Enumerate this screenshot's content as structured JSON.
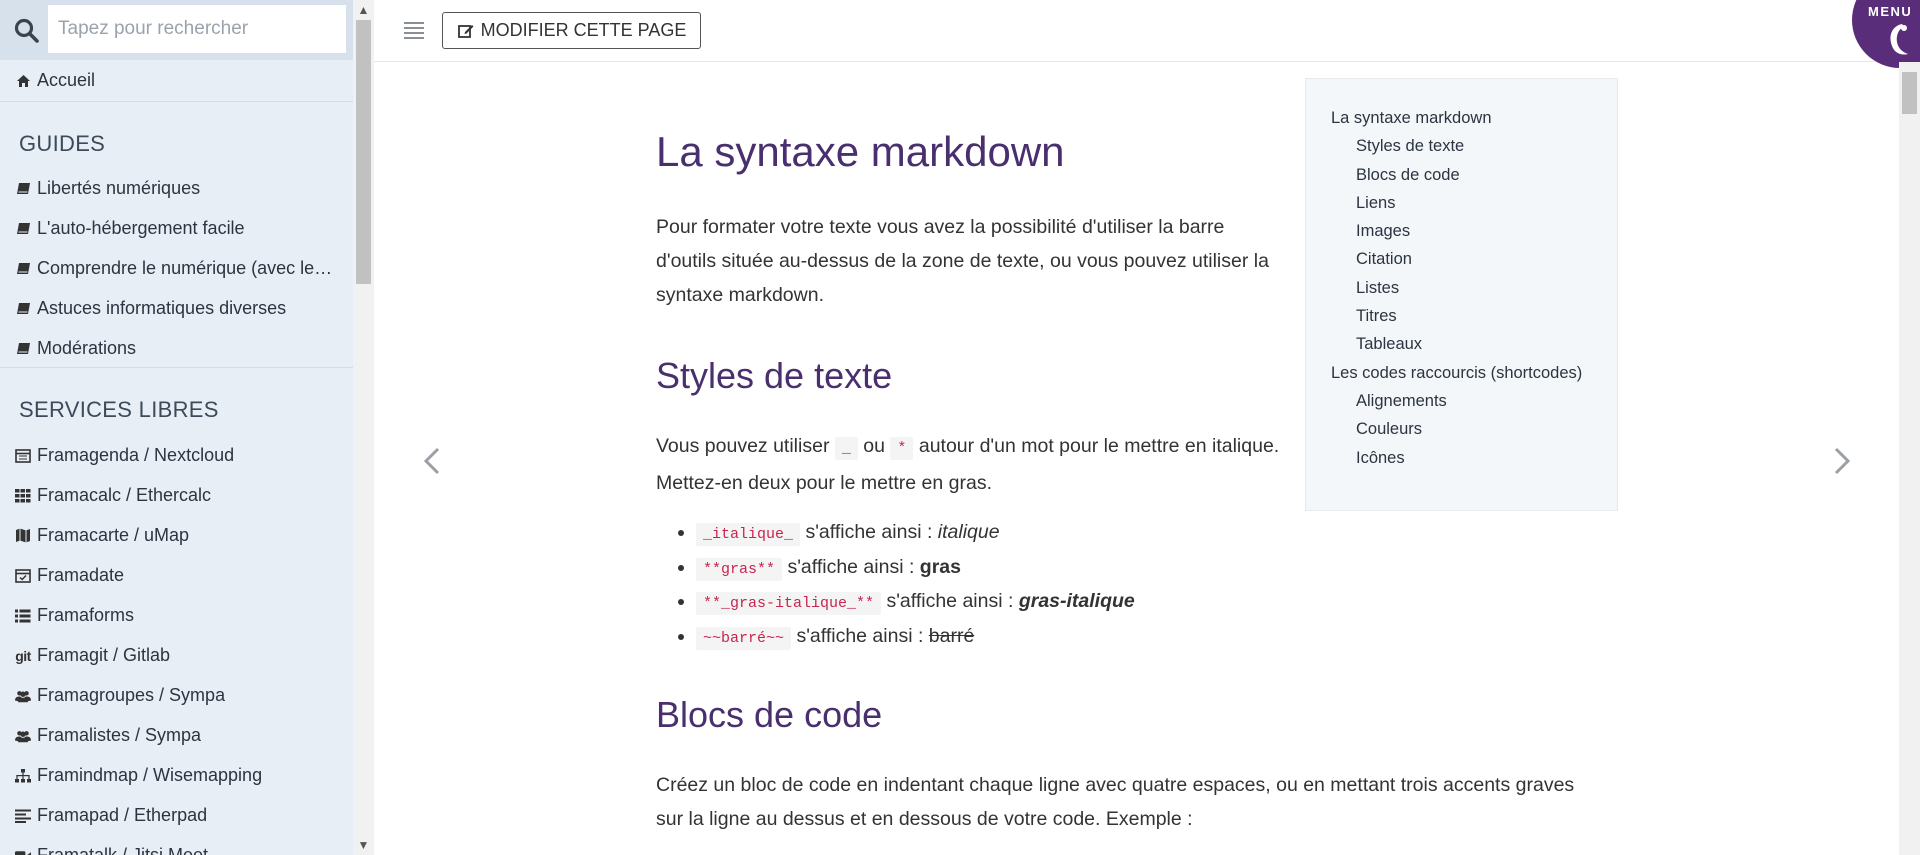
{
  "search": {
    "placeholder": "Tapez pour rechercher"
  },
  "sidebar": {
    "home": "Accueil",
    "guides_title": "GUIDES",
    "guides": [
      "Libertés numériques",
      "L'auto-hébergement facile",
      "Comprendre le numérique (avec le…",
      "Astuces informatiques diverses",
      "Modérations"
    ],
    "services_title": "SERVICES LIBRES",
    "services": [
      {
        "label": "Framagenda / Nextcloud",
        "icon": "calendar-icon"
      },
      {
        "label": "Framacalc / Ethercalc",
        "icon": "table-icon"
      },
      {
        "label": "Framacarte / uMap",
        "icon": "map-icon"
      },
      {
        "label": "Framadate",
        "icon": "calendar-check-icon"
      },
      {
        "label": "Framaforms",
        "icon": "list-icon"
      },
      {
        "label": "Framagit / Gitlab",
        "icon": "git-icon"
      },
      {
        "label": "Framagroupes / Sympa",
        "icon": "users-icon"
      },
      {
        "label": "Framalistes / Sympa",
        "icon": "users-icon"
      },
      {
        "label": "Framindmap / Wisemapping",
        "icon": "sitemap-icon"
      },
      {
        "label": "Framapad / Etherpad",
        "icon": "align-left-icon"
      },
      {
        "label": "Framatalk / Jitsi Meet",
        "icon": "video-icon"
      }
    ]
  },
  "toolbar": {
    "edit_label": "MODIFIER CETTE PAGE",
    "menu_label": "MENU"
  },
  "article": {
    "title": "La syntaxe markdown",
    "intro": "Pour formater votre texte vous avez la possibilité d'utiliser la barre d'outils située au-dessus de la zone de texte, ou vous pouvez utiliser la syntaxe markdown.",
    "styles_heading": "Styles de texte",
    "styles_p1": "Vous pouvez utiliser",
    "styles_code1": "_",
    "styles_or": "ou",
    "styles_code2": "*",
    "styles_p2": "autour d'un mot pour le mettre en italique. Mettez-en deux pour le mettre en gras.",
    "list": [
      {
        "code": "_italique_",
        "text": "s'affiche ainsi :",
        "result": "italique"
      },
      {
        "code": "**gras**",
        "text": "s'affiche ainsi :",
        "result": "gras"
      },
      {
        "code": "**_gras-italique_**",
        "text": "s'affiche ainsi :",
        "result": "gras-italique"
      },
      {
        "code": "~~barré~~",
        "text": "s'affiche ainsi :",
        "result": "barré"
      }
    ],
    "code_heading": "Blocs de code",
    "code_p": "Créez un bloc de code en indentant chaque ligne avec quatre espaces, ou en mettant trois accents graves sur la ligne au dessus et en dessous de votre code. Exemple :"
  },
  "toc": [
    {
      "label": "La syntaxe markdown",
      "level": 1
    },
    {
      "label": "Styles de texte",
      "level": 2
    },
    {
      "label": "Blocs de code",
      "level": 2
    },
    {
      "label": "Liens",
      "level": 2
    },
    {
      "label": "Images",
      "level": 2
    },
    {
      "label": "Citation",
      "level": 2
    },
    {
      "label": "Listes",
      "level": 2
    },
    {
      "label": "Titres",
      "level": 2
    },
    {
      "label": "Tableaux",
      "level": 2
    },
    {
      "label": "Les codes raccourcis (shortcodes)",
      "level": 1
    },
    {
      "label": "Alignements",
      "level": 2
    },
    {
      "label": "Couleurs",
      "level": 2
    },
    {
      "label": "Icônes",
      "level": 2
    }
  ],
  "colors": {
    "accent": "#4a2f6e",
    "sidebar_bg": "#e8eef5",
    "code": "#c7254e"
  }
}
